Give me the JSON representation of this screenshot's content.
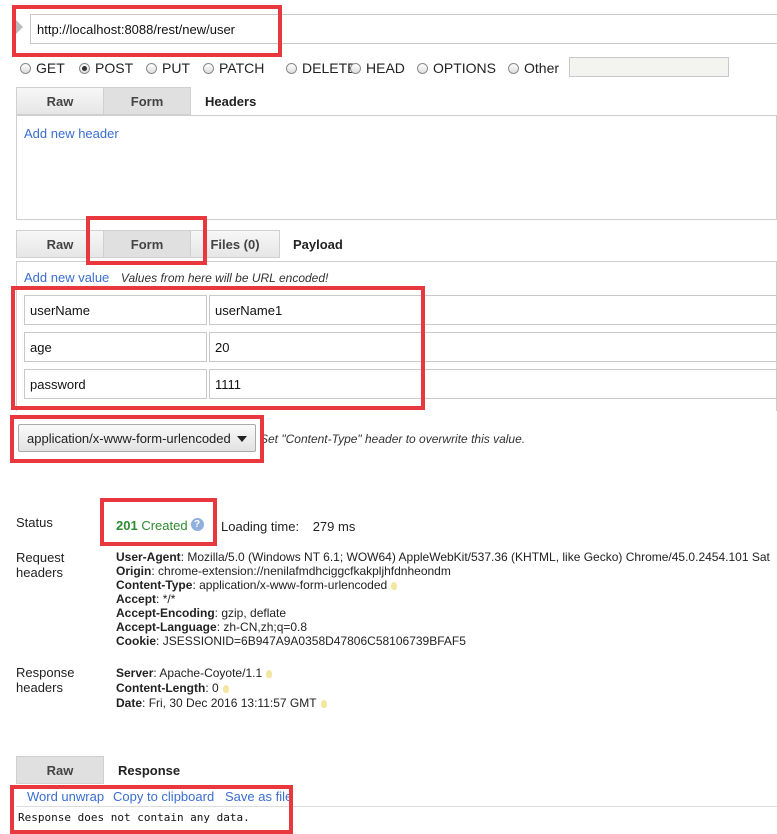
{
  "request": {
    "url": "http://localhost:8088/rest/new/user",
    "methods": [
      "GET",
      "POST",
      "PUT",
      "PATCH",
      "DELETE",
      "HEAD",
      "OPTIONS",
      "Other"
    ],
    "selected_method": "POST",
    "other_value": ""
  },
  "headers_section": {
    "tabs": [
      "Raw",
      "Form"
    ],
    "active_tab": "Form",
    "title": "Headers",
    "add_link": "Add new header"
  },
  "payload_section": {
    "tabs": [
      "Raw",
      "Form",
      "Files (0)"
    ],
    "active_tab": "Form",
    "title": "Payload",
    "add_link": "Add new value",
    "hint": "Values from here will be URL encoded!",
    "rows": [
      {
        "key": "userName",
        "value": "userName1"
      },
      {
        "key": "age",
        "value": "20"
      },
      {
        "key": "password",
        "value": "1111"
      }
    ],
    "content_type": "application/x-www-form-urlencoded",
    "content_type_hint": "Set \"Content-Type\" header to overwrite this value."
  },
  "status": {
    "label": "Status",
    "code": "201",
    "text": "Created",
    "loading_label": "Loading time:",
    "loading_value": "279 ms"
  },
  "request_headers": {
    "label_line1": "Request",
    "label_line2": "headers",
    "items": [
      {
        "name": "User-Agent",
        "value": "Mozilla/5.0 (Windows NT 6.1; WOW64) AppleWebKit/537.36 (KHTML, like Gecko) Chrome/45.0.2454.101 Sat"
      },
      {
        "name": "Origin",
        "value": "chrome-extension://nenilafmdhciggcfkakpljhfdnheondm"
      },
      {
        "name": "Content-Type",
        "value": "application/x-www-form-urlencoded"
      },
      {
        "name": "Accept",
        "value": "*/*"
      },
      {
        "name": "Accept-Encoding",
        "value": "gzip, deflate"
      },
      {
        "name": "Accept-Language",
        "value": "zh-CN,zh;q=0.8"
      },
      {
        "name": "Cookie",
        "value": "JSESSIONID=6B947A9A0358D47806C58106739BFAF5"
      }
    ]
  },
  "response_headers": {
    "label_line1": "Response",
    "label_line2": "headers",
    "items": [
      {
        "name": "Server",
        "value": "Apache-Coyote/1.1"
      },
      {
        "name": "Content-Length",
        "value": "0"
      },
      {
        "name": "Date",
        "value": "Fri, 30 Dec 2016 13:11:57 GMT"
      }
    ]
  },
  "response_section": {
    "tab": "Raw",
    "title": "Response",
    "actions": [
      "Word unwrap",
      "Copy to clipboard",
      "Save as file"
    ],
    "body": "Response does not contain any data."
  },
  "colors": {
    "highlight": "#e8383d",
    "link": "#3a6ed0",
    "status_ok": "#2e8b2e"
  }
}
